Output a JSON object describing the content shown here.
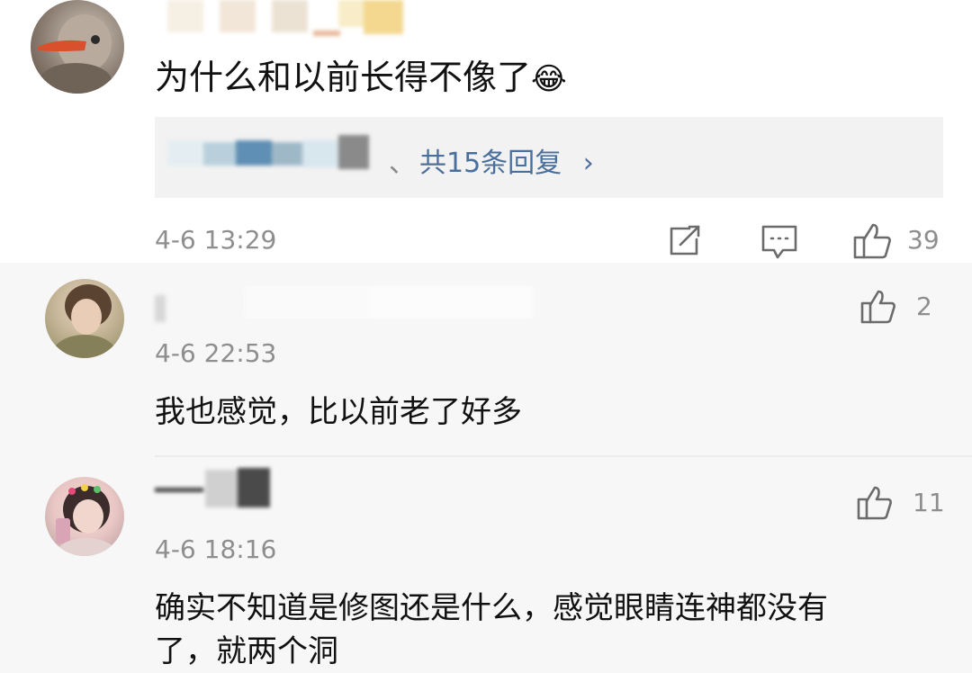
{
  "comment_main": {
    "text": "为什么和以前长得不像了",
    "emoji": "😂",
    "reply_sep": "、",
    "replies_link": "共15条回复",
    "replies_chevron": "›",
    "time": "4-6 13:29",
    "like_count": "39",
    "icons": [
      "share-icon",
      "comment-icon",
      "thumbs-up-icon"
    ]
  },
  "replies": [
    {
      "time": "4-6 22:53",
      "like_count": "2",
      "text": "我也感觉，比以前老了好多"
    },
    {
      "time": "4-6 18:16",
      "like_count": "11",
      "text_line1": "确实不知道是修图还是什么，感觉眼睛连神都没有",
      "text_line2": "了，就两个洞"
    }
  ],
  "colors": {
    "link": "#4a6f9c",
    "meta": "#8e8e8e",
    "reply_bg": "#f2f2f2",
    "thread_bg": "#f7f7f7"
  }
}
